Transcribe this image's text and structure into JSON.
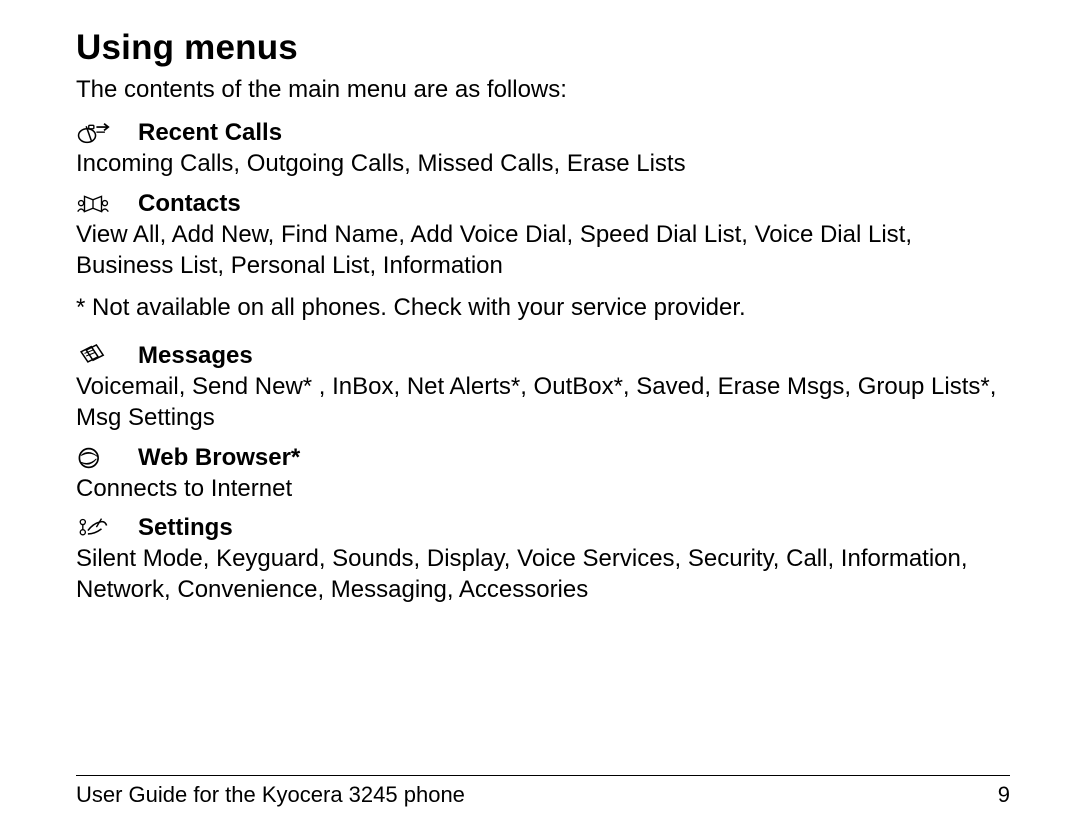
{
  "title": "Using menus",
  "intro": "The contents of the main menu are as follows:",
  "note": "* Not available on all phones. Check with your service provider.",
  "sections": {
    "recent_calls": {
      "title": "Recent Calls",
      "body": "Incoming Calls, Outgoing Calls, Missed Calls, Erase Lists"
    },
    "contacts": {
      "title": "Contacts",
      "body": "View All, Add New, Find Name, Add Voice Dial, Speed Dial List, Voice Dial List, Business List, Personal List, Information"
    },
    "messages": {
      "title": "Messages",
      "body": "Voicemail, Send New* , InBox, Net Alerts*, OutBox*, Saved, Erase Msgs, Group Lists*, Msg Settings"
    },
    "web_browser": {
      "title": "Web Browser*",
      "body": "Connects to Internet"
    },
    "settings": {
      "title": "Settings",
      "body": "Silent Mode, Keyguard, Sounds, Display, Voice Services, Security, Call, Information, Network, Convenience, Messaging, Accessories"
    }
  },
  "footer": {
    "text": "User Guide for the Kyocera 3245 phone",
    "page": "9"
  }
}
